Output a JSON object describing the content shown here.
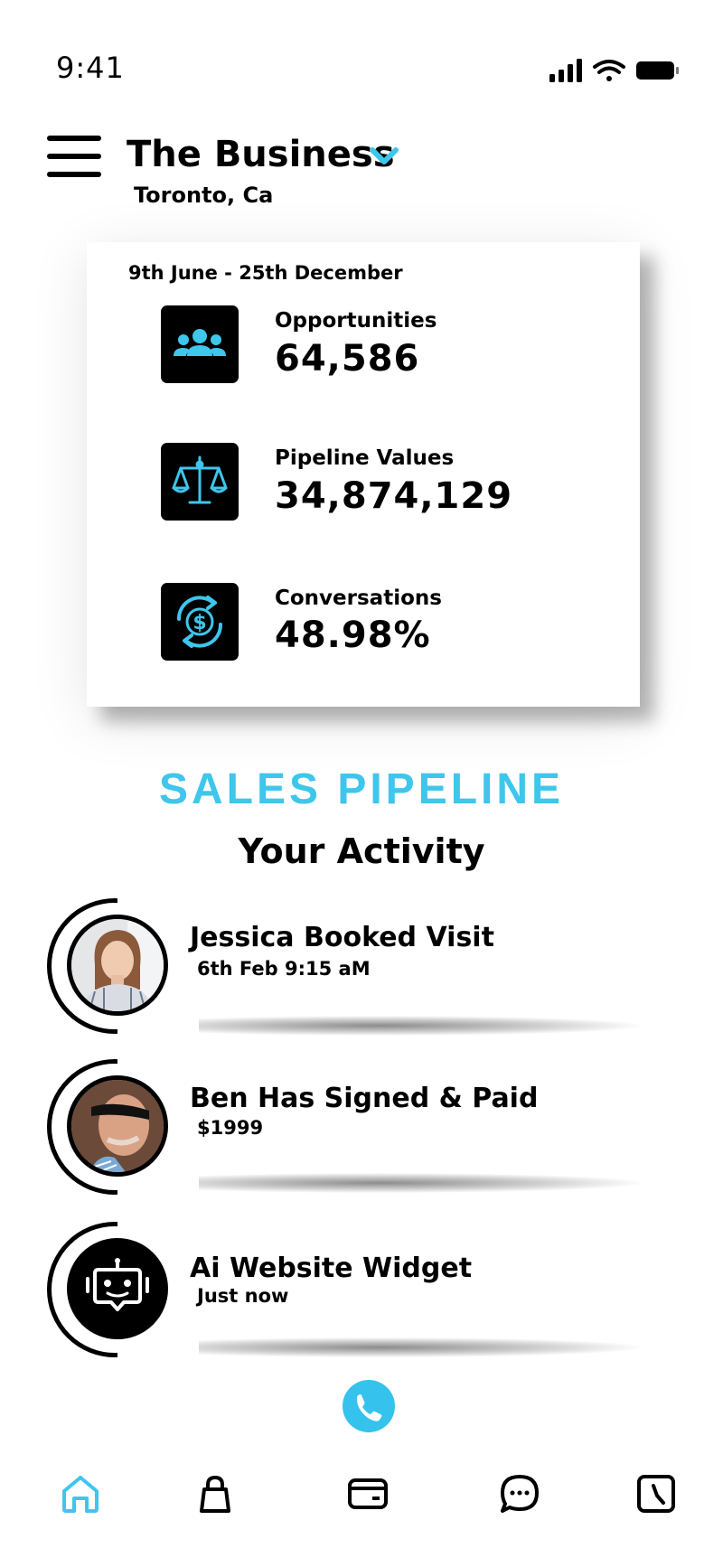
{
  "status_bar": {
    "time": "9:41"
  },
  "header": {
    "title": "The Business",
    "location": "Toronto, Ca"
  },
  "stats": {
    "date_range": "9th June - 25th December",
    "items": [
      {
        "label": "Opportunities",
        "value": "64,586",
        "icon": "people-group-icon"
      },
      {
        "label": "Pipeline Values",
        "value": "34,874,129",
        "icon": "scale-balance-icon"
      },
      {
        "label": "Conversations",
        "value": "48.98%",
        "icon": "dollar-exchange-icon"
      }
    ]
  },
  "section": {
    "title": "SALES PIPELINE",
    "subtitle": "Your Activity"
  },
  "activity": [
    {
      "title": "Jessica Booked Visit",
      "subtitle": "6th Feb  9:15 aM",
      "avatar": "woman-avatar"
    },
    {
      "title": "Ben Has Signed & Paid",
      "subtitle": "$1999",
      "avatar": "man-sunglasses-avatar"
    },
    {
      "title": "Ai Website Widget",
      "subtitle": "Just now",
      "avatar": "robot-chat-icon"
    }
  ],
  "colors": {
    "accent": "#3ec6ec",
    "text": "#000000",
    "background": "#ffffff"
  },
  "bottom_nav": [
    "home-icon",
    "bag-icon",
    "wallet-icon",
    "chat-bubble-icon",
    "clock-icon"
  ]
}
